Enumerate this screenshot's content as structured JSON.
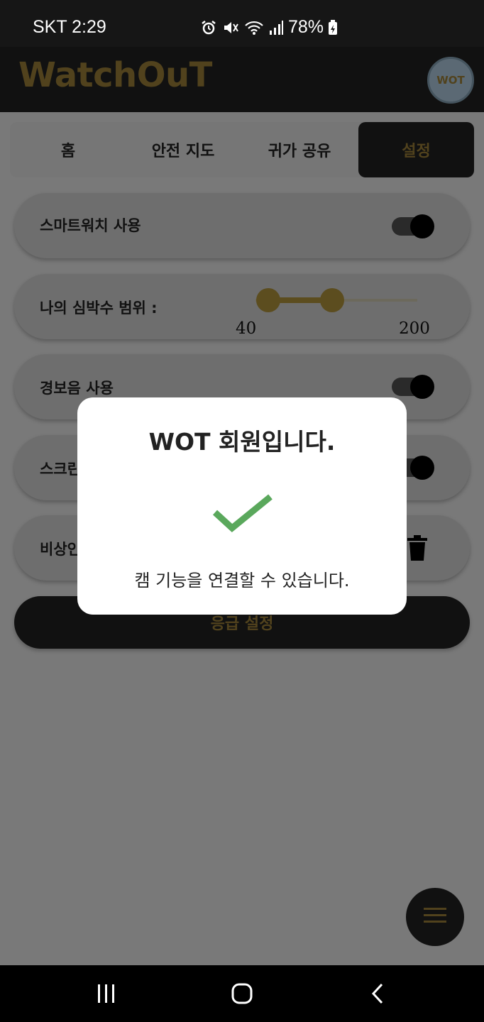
{
  "status_bar": {
    "carrier_time": "SKT 2:29",
    "battery": "78%",
    "icons": [
      "alarm-icon",
      "vibrate-mute-icon",
      "wifi-icon",
      "signal-icon",
      "battery-charging-icon"
    ]
  },
  "header": {
    "title": "WatchOuT",
    "logo_text": "WOT",
    "title_color": "#a2853a",
    "bg_color": "#232323"
  },
  "tabs": [
    {
      "label": "홈"
    },
    {
      "label": "안전 지도"
    },
    {
      "label": "귀가 공유"
    },
    {
      "label": "설정"
    }
  ],
  "tabs_active_color": "#a2853a",
  "settings": {
    "smartwatch": {
      "label": "스마트워치 사용",
      "enabled": true
    },
    "heart_rate": {
      "label": "나의 심박수 범위 :",
      "min_label": "40",
      "max_label": "200",
      "range_min": 40,
      "range_max": 200
    },
    "alarm_sound": {
      "label": "경보음 사용",
      "enabled": true
    },
    "screen_row": {
      "label": "스크린",
      "enabled": true
    },
    "emergency_row": {
      "label": "비상인",
      "icon": "trash-icon"
    }
  },
  "emergency_button": {
    "label": "응급 설정"
  },
  "fab": {
    "icon": "menu-icon"
  },
  "dialog": {
    "title": "WOT 회원입니다.",
    "icon": "check-icon",
    "icon_color": "#5aa85c",
    "message": "캠 기능을 연결할 수 있습니다."
  },
  "nav_bar": {
    "items": [
      "recent-apps-icon",
      "home-icon",
      "back-icon"
    ]
  }
}
